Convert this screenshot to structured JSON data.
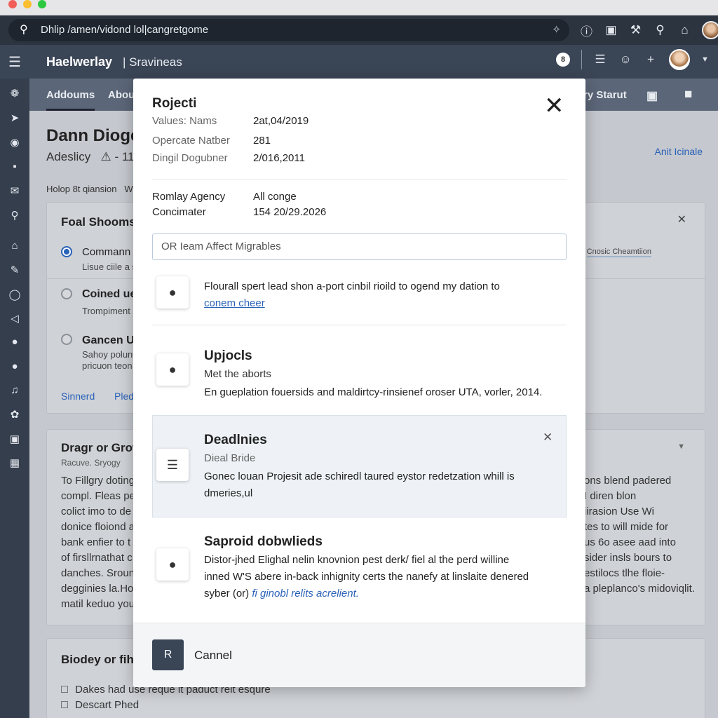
{
  "browser": {
    "url": "Dhlip /amen/vidond lol|cangretgome",
    "dots": [
      "#f25f58",
      "#fbbe2e",
      "#2bc840"
    ],
    "icons": [
      "info-icon",
      "save-icon",
      "tools-icon",
      "search-icon",
      "home-icon"
    ]
  },
  "header": {
    "brand": "Haelwerlay",
    "subtitle": "| Sravineas",
    "notification_badge": "8"
  },
  "tabs": [
    "Addoums",
    "Abou",
    "ry Starut"
  ],
  "page": {
    "title": "Dann Dioge",
    "subtitle": "Adeslicy",
    "subtitle_tail": "- 11",
    "link": "Anit Icinale",
    "help": "Holop 8t qiansion",
    "help_tail": "W",
    "card1": {
      "title": "Foal Shooms",
      "options": [
        {
          "title": "Commann",
          "desc": "Lisue ciile a s"
        },
        {
          "title": "Coined ue",
          "desc": "Trompiment"
        },
        {
          "title": "Gancen Up",
          "desc": "Sahoy polunt",
          "desc2": "pricuon teon"
        }
      ],
      "footer_links": [
        "Sinnerd",
        "Pled"
      ],
      "right_tag": "Cnosic Cheamtiion"
    },
    "card2": {
      "title": "Dragr or Grow",
      "subtitle": "Racuve. Sryogy",
      "left_lines": [
        "To Fillgry doting",
        "compl. Fleas pe",
        "colict imo to de",
        "donice floiond a",
        "bank enfier to t",
        "of firsllrnathat c",
        "danches. Sroun",
        "degginies la.Hoo",
        "matil keduo you"
      ],
      "right_lines": [
        "ons blend padered",
        "I diren blon",
        "iirasion Use Wi",
        "tes to will mide for",
        "us 6o asee aad into",
        "sider insls bours to",
        "estilocs tlhe floie-",
        "a pleplanco's midoviqlit."
      ]
    },
    "card3": {
      "title": "Biodey or fih",
      "items": [
        "Dakes had use reque it paduct relt esqure",
        "Descart Phed"
      ]
    }
  },
  "modal": {
    "title": "Rojecti",
    "fields": [
      {
        "key": "Values: Nams",
        "value": "2at,04/2019"
      },
      {
        "key": "Opercate Natber",
        "value": "281"
      },
      {
        "key": "Dingil Dogubner",
        "value": "2/016,2011"
      },
      {
        "key": "Romlay Agency",
        "value": "All conge"
      },
      {
        "key": "Concimater",
        "value": "154 20/29.2026"
      }
    ],
    "search_placeholder": "OR  Ieam Affect Migrables",
    "item1": {
      "text": "Flourall spert lead shon a-port cinbil rioild to ogend my dation to",
      "link": "conem cheer"
    },
    "item2": {
      "title": "Upjocls",
      "subtitle": "Met the aborts",
      "text": "En gueplation fouersids and maldirtcy-rinsienef oroser UTA, vorler, 2014."
    },
    "item3": {
      "title": "Deadlnies",
      "subtitle": "Dieal Bride",
      "text": "Gonec louan Projesit ade schiredl taured eystor redetzation whill is",
      "text2": "dmeries,ul"
    },
    "item4": {
      "title": "Saproid dobwlieds",
      "line1": "Distor-jhed Elighal nelin knovnion pest derk/ fiel al the perd willine",
      "line2": "inned W'S abere in-back inhignity certs the nanefy at linslaite denered",
      "line3_pre": "syber (or) ",
      "line3_link": "fi ginobl relits acrelient."
    },
    "footer": {
      "primary": "R",
      "cancel": "Cannel"
    }
  }
}
